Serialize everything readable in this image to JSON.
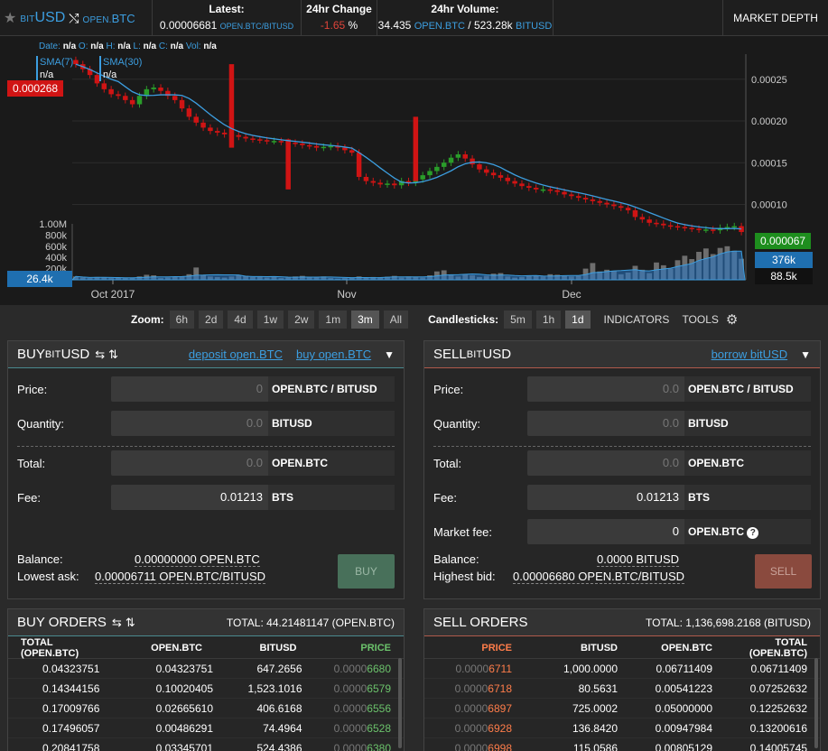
{
  "header": {
    "base_prefix": "BIT",
    "base": "USD",
    "swap_icon": "shuffle-icon",
    "quote_prefix": "OPEN.",
    "quote": "BTC",
    "latest_label": "Latest:",
    "latest_value": "0.00006681",
    "latest_unit": "OPEN.BTC/BITUSD",
    "change_label": "24hr Change",
    "change_value": "-1.65",
    "change_unit": "%",
    "volume_label": "24hr Volume:",
    "volume_value1": "34.435",
    "volume_unit1": "OPEN.BTC",
    "volume_sep": "/",
    "volume_value2": "523.28k",
    "volume_unit2": "BITUSD",
    "market_depth": "MARKET DEPTH"
  },
  "chart": {
    "ohlc_date_l": "Date:",
    "ohlc_date_v": "n/a",
    "ohlc_o_l": "O:",
    "ohlc_o_v": "n/a",
    "ohlc_h_l": "H:",
    "ohlc_h_v": "n/a",
    "ohlc_l_l": "L:",
    "ohlc_l_v": "n/a",
    "ohlc_c_l": "C:",
    "ohlc_c_v": "n/a",
    "ohlc_vol_l": "Vol:",
    "ohlc_vol_v": "n/a",
    "sma7_label": "SMA(7)",
    "sma7_value": "n/a",
    "sma30_label": "SMA(30)",
    "sma30_value": "n/a",
    "tag_high": "0.000268",
    "tag_close": "0.000067",
    "tag_vol_left": "26.4k",
    "tag_vol_blue": "376k",
    "tag_vol_black": "88.5k",
    "price_ticks": [
      "0.00025",
      "0.00020",
      "0.00015",
      "0.00010"
    ],
    "volume_ticks": [
      "1.00M",
      "800k",
      "600k",
      "400k",
      "200k"
    ],
    "date_ticks": [
      "Oct 2017",
      "Nov",
      "Dec"
    ],
    "colors": {
      "up": "#2a9d2a",
      "down": "#d01414",
      "sma": "#3c9ee0",
      "volume": "#777777"
    }
  },
  "chart_data": {
    "type": "candlestick",
    "x_ticks": [
      "Oct 2017",
      "Nov",
      "Dec"
    ],
    "price_ticks": [
      0.00025,
      0.0002,
      0.00015,
      0.0001
    ],
    "volume_ticks": [
      "1.00M",
      "800k",
      "600k",
      "400k",
      "200k"
    ],
    "ylim": [
      8e-05,
      0.00028
    ],
    "close": [
      0.000268,
      0.000262,
      0.000255,
      0.000245,
      0.000238,
      0.000232,
      0.00023,
      0.000225,
      0.00022,
      0.00023,
      0.000238,
      0.00024,
      0.000236,
      0.00023,
      0.000225,
      0.000215,
      0.000205,
      0.000198,
      0.000192,
      0.000188,
      0.000186,
      0.000184,
      0.000183,
      0.000181,
      0.000179,
      0.000178,
      0.000177,
      0.000176,
      0.000176,
      0.000175,
      0.000174,
      0.000173,
      0.000171,
      0.00017,
      0.000168,
      0.000169,
      0.00017,
      0.000168,
      0.000165,
      0.000162,
      0.000133,
      0.000128,
      0.000126,
      0.000124,
      0.000125,
      0.000123,
      0.000128,
      0.000126,
      0.00013,
      0.000135,
      0.00014,
      0.000145,
      0.00015,
      0.000156,
      0.00016,
      0.000155,
      0.000148,
      0.000142,
      0.000138,
      0.000135,
      0.000132,
      0.000128,
      0.000125,
      0.000122,
      0.00012,
      0.000118,
      0.000118,
      0.000117,
      0.000115,
      0.000112,
      0.00011,
      0.000108,
      0.000106,
      0.000104,
      0.000102,
      0.0001,
      9.8e-05,
      9.6e-05,
      9.3e-05,
      8.5e-05,
      8.2e-05,
      7.8e-05,
      7.7e-05,
      7.5e-05,
      7.4e-05,
      7.3e-05,
      7.2e-05,
      7.1e-05,
      7e-05,
      7e-05,
      6.9e-05,
      7.2e-05,
      7.3e-05,
      7.4e-05,
      6.7e-05
    ],
    "volume_k": [
      60,
      40,
      30,
      50,
      40,
      30,
      35,
      30,
      40,
      60,
      90,
      80,
      30,
      40,
      50,
      60,
      100,
      220,
      90,
      60,
      50,
      40,
      60,
      80,
      70,
      50,
      60,
      40,
      50,
      30,
      40,
      60,
      70,
      50,
      40,
      60,
      30,
      20,
      30,
      40,
      60,
      40,
      50,
      45,
      55,
      70,
      40,
      60,
      50,
      40,
      80,
      150,
      170,
      90,
      60,
      100,
      80,
      50,
      70,
      110,
      120,
      60,
      40,
      50,
      70,
      80,
      60,
      100,
      90,
      70,
      60,
      70,
      200,
      300,
      150,
      180,
      160,
      100,
      130,
      250,
      180,
      120,
      310,
      260,
      200,
      350,
      430,
      370,
      500,
      560,
      460,
      570,
      600,
      520,
      376
    ]
  },
  "zoom": {
    "label": "Zoom:",
    "options": [
      "6h",
      "2d",
      "4d",
      "1w",
      "2w",
      "1m",
      "3m",
      "All"
    ],
    "active": "3m",
    "candle_label": "Candlesticks:",
    "candle_options": [
      "5m",
      "1h",
      "1d"
    ],
    "candle_active": "1d",
    "indicators": "INDICATORS",
    "tools": "TOOLS"
  },
  "buy": {
    "title": "BUY ",
    "title_prefix": "BIT",
    "title_asset": "USD",
    "deposit_link": "deposit open.BTC",
    "buy_link": "buy open.BTC",
    "price_label": "Price:",
    "price_value": "0",
    "price_unit": "OPEN.BTC / BITUSD",
    "qty_label": "Quantity:",
    "qty_value": "0.0",
    "qty_unit": "BITUSD",
    "total_label": "Total:",
    "total_value": "0.0",
    "total_unit": "OPEN.BTC",
    "fee_label": "Fee:",
    "fee_value": "0.01213",
    "fee_unit": "BTS",
    "balance_label": "Balance:",
    "balance_value": "0.00000000 OPEN.BTC",
    "lowest_label": "Lowest ask:",
    "lowest_value": "0.00006711 OPEN.BTC/BITUSD",
    "button": "BUY"
  },
  "sell": {
    "title": "SELL ",
    "title_prefix": "BIT",
    "title_asset": "USD",
    "borrow_link": "borrow bitUSD",
    "price_label": "Price:",
    "price_value": "0.0",
    "price_unit": "OPEN.BTC / BITUSD",
    "qty_label": "Quantity:",
    "qty_value": "0.0",
    "qty_unit": "BITUSD",
    "total_label": "Total:",
    "total_value": "0.0",
    "total_unit": "OPEN.BTC",
    "fee_label": "Fee:",
    "fee_value": "0.01213",
    "fee_unit": "BTS",
    "mfee_label": "Market fee:",
    "mfee_value": "0",
    "mfee_unit": "OPEN.BTC",
    "balance_label": "Balance:",
    "balance_value": "0.0000 BITUSD",
    "highest_label": "Highest bid:",
    "highest_value": "0.00006680 OPEN.BTC/BITUSD",
    "button": "SELL"
  },
  "buy_orders": {
    "title": "BUY ORDERS",
    "total": "TOTAL: 44.21481147 (OPEN.BTC)",
    "headers": [
      "TOTAL (OPEN.BTC)",
      "OPEN.BTC",
      "BITUSD",
      "PRICE"
    ],
    "rows": [
      [
        "0.04323751",
        "0.04323751",
        "647.2656",
        "0.0000",
        "6680"
      ],
      [
        "0.14344156",
        "0.10020405",
        "1,523.1016",
        "0.0000",
        "6579"
      ],
      [
        "0.17009766",
        "0.02665610",
        "406.6168",
        "0.0000",
        "6556"
      ],
      [
        "0.17496057",
        "0.00486291",
        "74.4964",
        "0.0000",
        "6528"
      ],
      [
        "0.20841758",
        "0.03345701",
        "524.4386",
        "0.0000",
        "6380"
      ]
    ]
  },
  "sell_orders": {
    "title": "SELL ORDERS",
    "total": "TOTAL: 1,136,698.2168 (BITUSD)",
    "headers": [
      "PRICE",
      "BITUSD",
      "OPEN.BTC",
      "TOTAL (OPEN.BTC)"
    ],
    "rows": [
      [
        "0.0000",
        "6711",
        "1,000.0000",
        "0.06711409",
        "0.06711409"
      ],
      [
        "0.0000",
        "6718",
        "80.5631",
        "0.00541223",
        "0.07252632"
      ],
      [
        "0.0000",
        "6897",
        "725.0002",
        "0.05000000",
        "0.12252632"
      ],
      [
        "0.0000",
        "6928",
        "136.8420",
        "0.00947984",
        "0.13200616"
      ],
      [
        "0.0000",
        "6998",
        "115.0586",
        "0.00805129",
        "0.14005745"
      ]
    ]
  }
}
